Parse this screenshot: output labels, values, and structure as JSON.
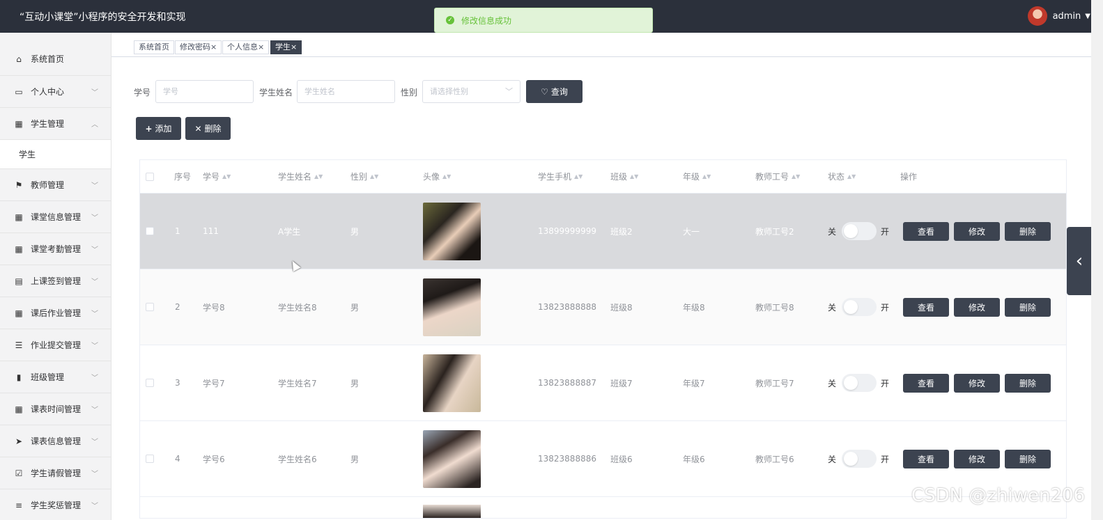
{
  "app": {
    "title": "“互动小课堂”小程序的安全开发和实现",
    "user": "admin"
  },
  "toast": {
    "message": "修改信息成功"
  },
  "sidebar": {
    "items": [
      {
        "label": "系统首页",
        "icon": "home-icon"
      },
      {
        "label": "个人中心",
        "icon": "card-icon"
      },
      {
        "label": "学生管理",
        "icon": "grid-icon",
        "expanded": true
      },
      {
        "label": "教师管理",
        "icon": "flag-icon"
      },
      {
        "label": "课堂信息管理",
        "icon": "grid-icon"
      },
      {
        "label": "课堂考勤管理",
        "icon": "grid-icon"
      },
      {
        "label": "上课签到管理",
        "icon": "clipboard-icon"
      },
      {
        "label": "课后作业管理",
        "icon": "grid-icon"
      },
      {
        "label": "作业提交管理",
        "icon": "sliders-icon"
      },
      {
        "label": "班级管理",
        "icon": "bar-chart-icon"
      },
      {
        "label": "课表时间管理",
        "icon": "grid-icon"
      },
      {
        "label": "课表信息管理",
        "icon": "send-icon"
      },
      {
        "label": "学生请假管理",
        "icon": "checklist-icon"
      },
      {
        "label": "学生奖惩管理",
        "icon": "list-icon"
      }
    ],
    "submenu": {
      "label": "学生"
    }
  },
  "tabs": [
    {
      "label": "系统首页"
    },
    {
      "label": "修改密码×"
    },
    {
      "label": "个人信息×"
    },
    {
      "label": "学生×",
      "active": true
    }
  ],
  "search": {
    "student_no_label": "学号",
    "student_no_placeholder": "学号",
    "name_label": "学生姓名",
    "name_placeholder": "学生姓名",
    "gender_label": "性别",
    "gender_placeholder": "请选择性别",
    "query_label": "查询"
  },
  "toolbar": {
    "add_label": "添加",
    "delete_label": "删除"
  },
  "table": {
    "columns": [
      "序号",
      "学号",
      "学生姓名",
      "性别",
      "头像",
      "学生手机",
      "班级",
      "年级",
      "教师工号",
      "状态",
      "操作"
    ],
    "switch_off": "关",
    "switch_on": "开",
    "actions": {
      "view": "查看",
      "edit": "修改",
      "delete": "删除"
    },
    "rows": [
      {
        "idx": "1",
        "no": "111",
        "name": "A学生",
        "gender": "男",
        "phone": "13899999999",
        "class": "班级2",
        "grade": "大一",
        "teacher": "教师工号2"
      },
      {
        "idx": "2",
        "no": "学号8",
        "name": "学生姓名8",
        "gender": "男",
        "phone": "13823888888",
        "class": "班级8",
        "grade": "年级8",
        "teacher": "教师工号8"
      },
      {
        "idx": "3",
        "no": "学号7",
        "name": "学生姓名7",
        "gender": "男",
        "phone": "13823888887",
        "class": "班级7",
        "grade": "年级7",
        "teacher": "教师工号7"
      },
      {
        "idx": "4",
        "no": "学号6",
        "name": "学生姓名6",
        "gender": "男",
        "phone": "13823888886",
        "class": "班级6",
        "grade": "年级6",
        "teacher": "教师工号6"
      }
    ]
  },
  "watermark": "CSDN @zhiwen206"
}
